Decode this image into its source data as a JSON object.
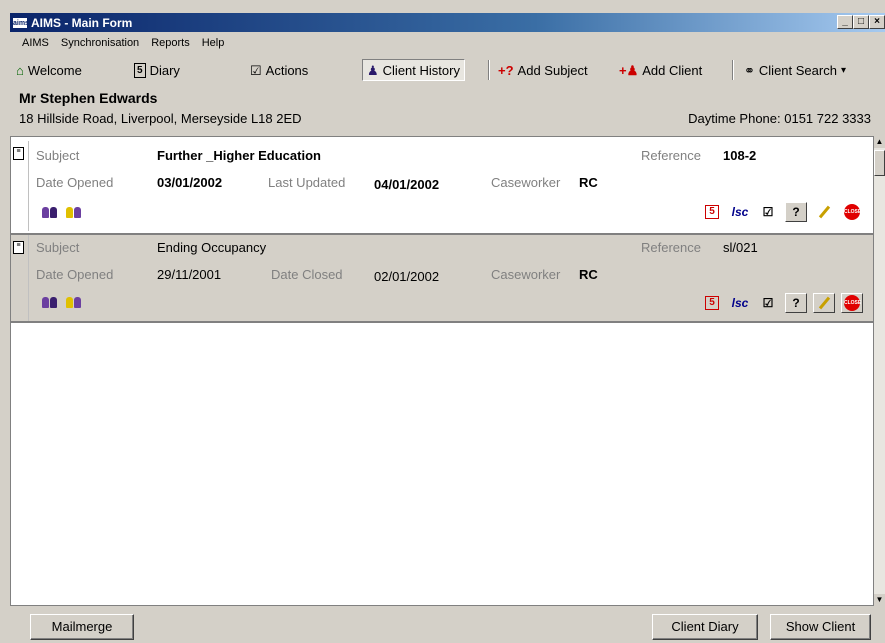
{
  "window": {
    "title": "AIMS - Main Form",
    "app_icon_text": "aims",
    "controls": [
      "_",
      "□",
      "×"
    ]
  },
  "menu": [
    "AIMS",
    "Synchronisation",
    "Reports",
    "Help"
  ],
  "toolbar": {
    "welcome": "Welcome",
    "diary": "Diary",
    "diary_icon_text": "5",
    "actions": "Actions",
    "client_history": "Client History",
    "add_subject": "Add Subject",
    "add_client": "Add Client",
    "client_search": "Client Search",
    "dropdown_arrow": "▾"
  },
  "client": {
    "name": "Mr Stephen Edwards",
    "address": "18 Hillside Road, Liverpool, Merseyside  L18 2ED",
    "phone": "Daytime Phone: 0151 722 3333"
  },
  "labels": {
    "subject": "Subject",
    "reference": "Reference",
    "date_opened": "Date Opened",
    "last_updated": "Last Updated",
    "date_closed": "Date Closed",
    "caseworker": "Caseworker"
  },
  "records": [
    {
      "subject": "Further _Higher Education",
      "reference": "108-2",
      "date_opened": "03/01/2002",
      "last_updated": "04/01/2002",
      "caseworker": "RC"
    },
    {
      "subject": "Ending Occupancy",
      "reference": "sl/021",
      "date_opened": "29/11/2001",
      "date_closed": "02/01/2002",
      "caseworker": "RC"
    }
  ],
  "action_icons": {
    "diary": "5",
    "lsc": "lsc",
    "help": "?",
    "close": "CLOSE"
  },
  "footer": {
    "mailmerge": "Mailmerge",
    "client_diary": "Client Diary",
    "show_client": "Show Client"
  }
}
